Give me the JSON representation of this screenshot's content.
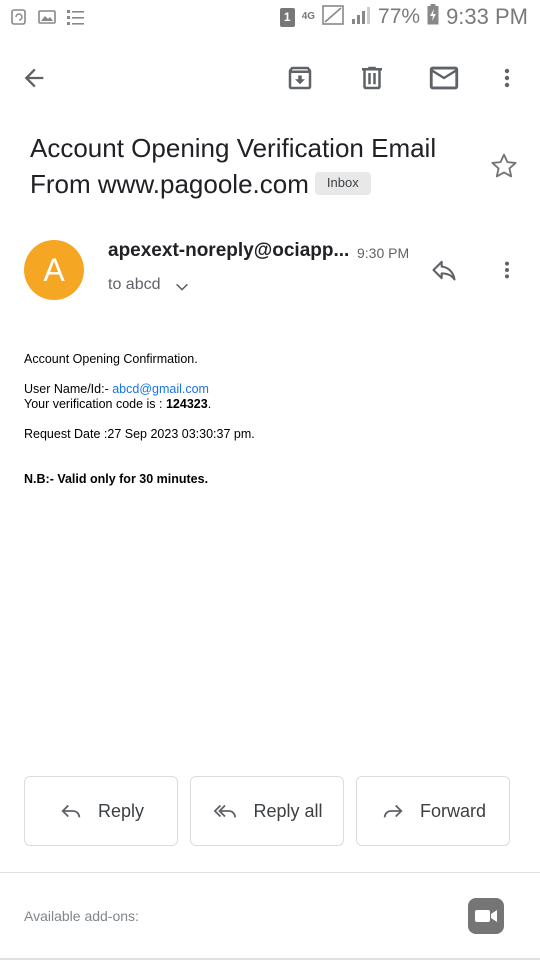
{
  "status_bar": {
    "sim_slot": "1",
    "network_type": "4G",
    "battery_percent": "77%",
    "time": "9:33 PM",
    "left_icons": [
      "sync-icon",
      "image-icon",
      "list-icon"
    ]
  },
  "toolbar": {
    "back_icon": "arrow-left-icon",
    "archive_icon": "archive-icon",
    "delete_icon": "trash-icon",
    "mark_unread_icon": "mail-icon",
    "more_icon": "more-vert-icon"
  },
  "email": {
    "subject": "Account Opening Verification Email From www.pagoole.com",
    "label": "Inbox",
    "sender_initial": "A",
    "avatar_color": "#f5a623",
    "sender": "apexext-noreply@ociapp...",
    "time": "9:30 PM",
    "to": "to abcd"
  },
  "body": {
    "line1": "Account Opening Confirmation.",
    "username_label": "User Name/Id:- ",
    "username_value": "abcd@gmail.com",
    "code_label": "Your verification code is : ",
    "code_value": "124323",
    "code_suffix": ".",
    "request_date": "Request Date :27 Sep 2023 03:30:37 pm.",
    "note": "N.B:- Valid only for 30 minutes."
  },
  "actions": {
    "reply": "Reply",
    "reply_all": "Reply all",
    "forward": "Forward"
  },
  "footer": {
    "addons_label": "Available add-ons:",
    "addon_icon": "video-camera-icon"
  },
  "colors": {
    "accent_link": "#1a73e8",
    "icon_gray": "#5f6368"
  }
}
